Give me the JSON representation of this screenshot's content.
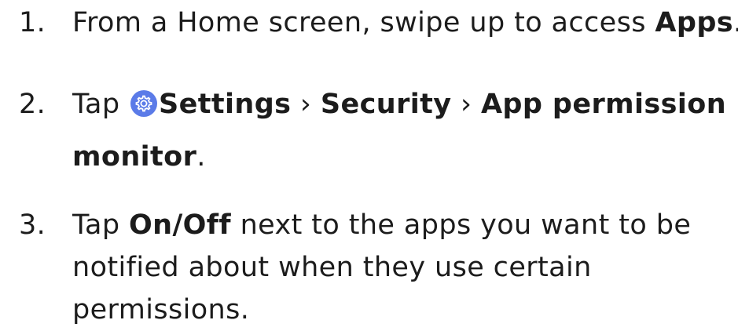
{
  "steps": [
    {
      "number": "1.",
      "line1": {
        "text": "From a Home screen, swipe up to access ",
        "bold": "Apps",
        "end": "."
      }
    },
    {
      "number": "2.",
      "line1": {
        "prefix": "Tap ",
        "icon": "settings-gear-icon",
        "b1": "Settings",
        "sep1": " › ",
        "b2": "Security",
        "sep2": " › ",
        "b3": "App permission"
      },
      "line2": {
        "bold": "monitor",
        "end": "."
      }
    },
    {
      "number": "3.",
      "line1": {
        "prefix": "Tap ",
        "bold": "On/Off",
        "rest": " next to the apps you want to be"
      },
      "line2": "notified about when they use certain",
      "line3": "permissions."
    }
  ],
  "colors": {
    "text": "#1c1c1c",
    "icon_bg": "#5b7be8"
  }
}
